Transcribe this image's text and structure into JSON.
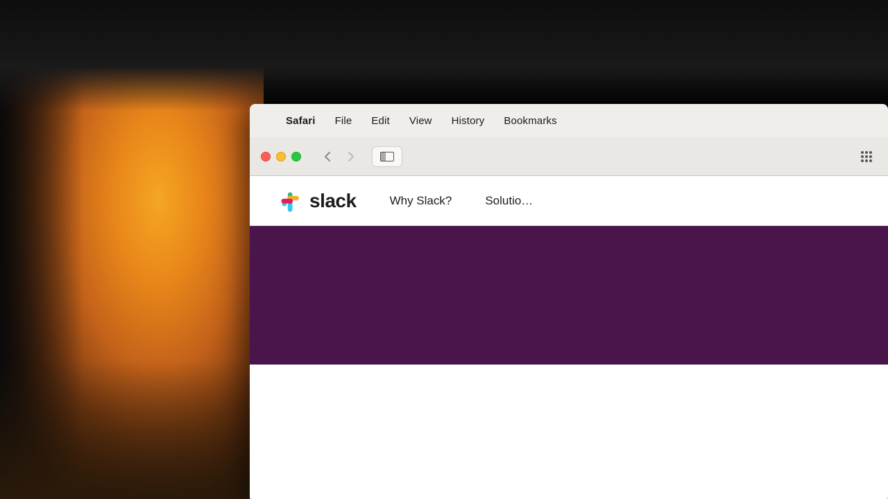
{
  "background": {
    "description": "warm bokeh lamp background photo"
  },
  "macos_menubar": {
    "apple_symbol": "",
    "items": [
      {
        "id": "safari",
        "label": "Safari",
        "bold": true
      },
      {
        "id": "file",
        "label": "File",
        "bold": false
      },
      {
        "id": "edit",
        "label": "Edit",
        "bold": false
      },
      {
        "id": "view",
        "label": "View",
        "bold": false
      },
      {
        "id": "history",
        "label": "History",
        "bold": false
      },
      {
        "id": "bookmarks",
        "label": "Bookmarks",
        "bold": false
      }
    ]
  },
  "safari_toolbar": {
    "back_button": "‹",
    "forward_button": "›"
  },
  "slack_navbar": {
    "wordmark": "slack",
    "nav_items": [
      {
        "id": "why-slack",
        "label": "Why Slack?"
      },
      {
        "id": "solutions",
        "label": "Solutio…"
      }
    ]
  },
  "slack_hero": {
    "background_color": "#4a154b"
  }
}
